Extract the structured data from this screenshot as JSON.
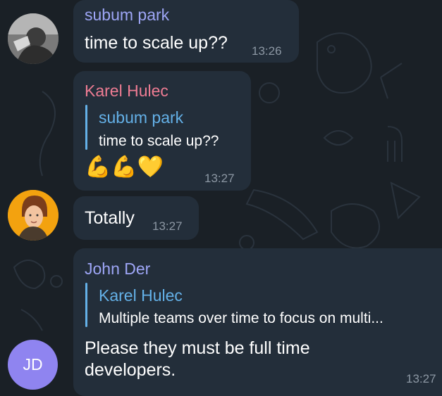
{
  "colors": {
    "background": "#1a2026",
    "bubble": "#232e3a",
    "sender_purple": "#9ea6f6",
    "sender_pink": "#ee7c93",
    "reply_blue": "#64b1e8",
    "time_gray": "#8c97a3",
    "avatar_jd": "#8f84f0"
  },
  "messages": [
    {
      "sender": "subum park",
      "avatar": "photo-avatar-grayscale",
      "text": "time to scale up??",
      "time": "13:26"
    },
    {
      "sender": "Karel Hulec",
      "reply": {
        "name": "subum park",
        "text": "time to scale up??"
      },
      "text": "💪💪💛",
      "time": "13:27"
    },
    {
      "avatar": "photo-avatar-cartoon",
      "text": "Totally",
      "time": "13:27"
    },
    {
      "sender": "John Der",
      "avatar_initials": "JD",
      "reply": {
        "name": "Karel Hulec",
        "text": "Multiple teams over time to focus on multi..."
      },
      "text_line1": "Please they must be full time",
      "text_line2": "developers.",
      "time": "13:27"
    }
  ]
}
